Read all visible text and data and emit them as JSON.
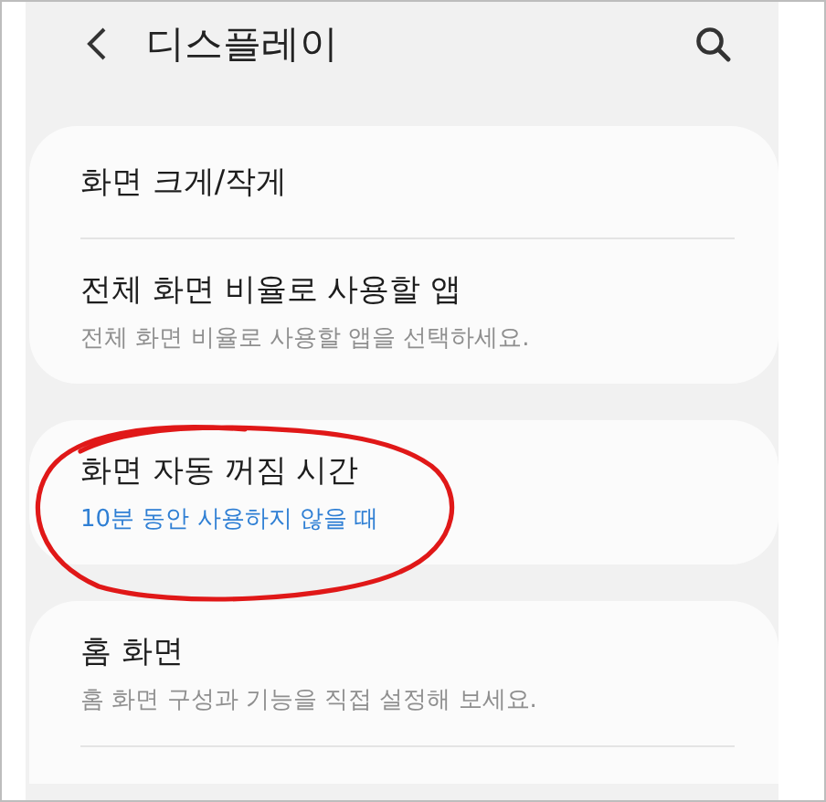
{
  "header": {
    "title": "디스플레이"
  },
  "cards": [
    {
      "items": [
        {
          "title": "화면 크게/작게"
        },
        {
          "title": "전체 화면 비율로 사용할 앱",
          "summary": {
            "text": "전체 화면 비율로 사용할 앱을 선택하세요.",
            "kind": "hint"
          }
        }
      ],
      "cut": false
    },
    {
      "items": [
        {
          "title": "화면 자동 꺼짐 시간",
          "summary": {
            "text": "10분 동안 사용하지 않을 때",
            "kind": "value"
          }
        }
      ],
      "cut": false,
      "circled": true
    },
    {
      "items": [
        {
          "title": "홈 화면",
          "summary": {
            "text": "홈 화면 구성과 기능을 직접 설정해 보세요.",
            "kind": "hint"
          }
        }
      ],
      "cut": true
    }
  ]
}
